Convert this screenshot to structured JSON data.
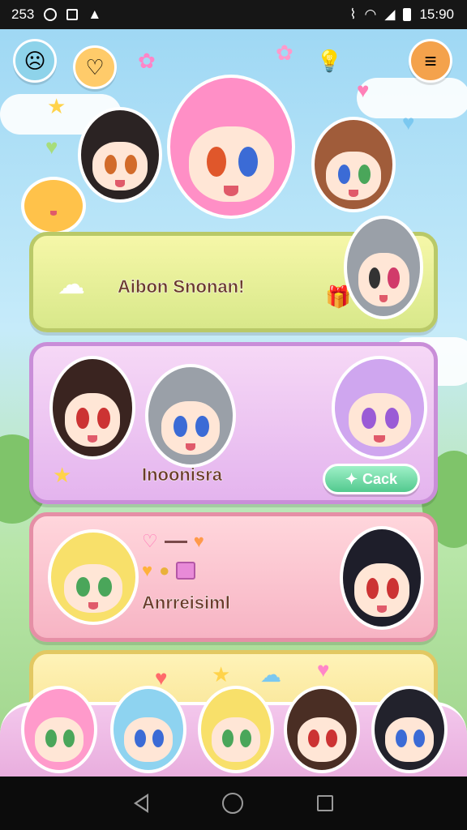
{
  "status_bar": {
    "left_text": "253",
    "time": "15:90"
  },
  "cards": [
    {
      "title": "Aibon Snonan!"
    },
    {
      "title": "Inoonisra",
      "button_label": "Cack",
      "button_icon": "plus-icon"
    },
    {
      "title": "Anrreisiml"
    },
    {
      "title": ""
    }
  ],
  "colors": {
    "accent_green": "#52c98e",
    "title_brown": "#6b3a2a",
    "card_pink": "#f7b4c4",
    "card_purple": "#e4b4ee",
    "card_yellow": "#f6e08a"
  },
  "icons": {
    "top_left": "sad-face-icon",
    "top_left2": "heart-bubble-icon",
    "top_flower": "flower-icon",
    "top_right": "menu-icon"
  }
}
